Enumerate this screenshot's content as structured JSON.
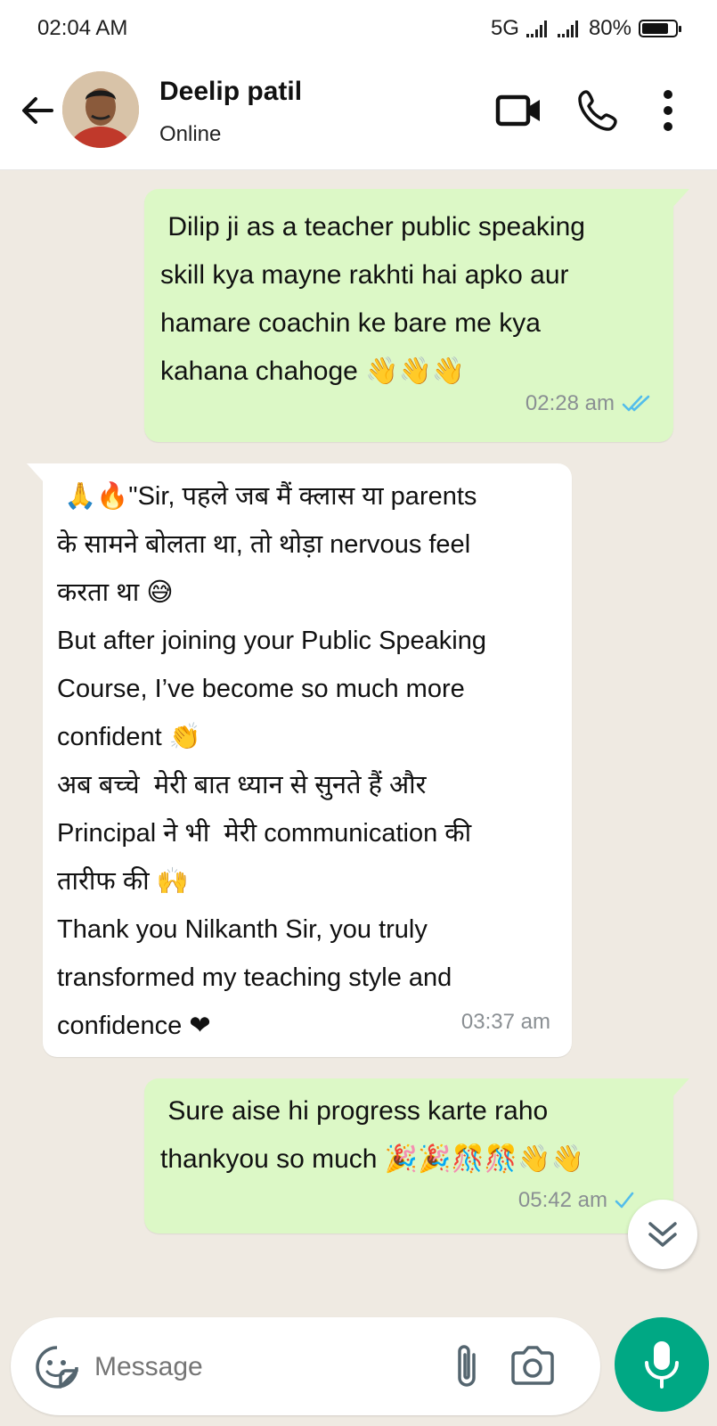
{
  "status_bar": {
    "time": "02:04 AM",
    "network": "5G",
    "battery_percent": "80%",
    "battery_level": 0.8
  },
  "header": {
    "contact_name": "Deelip patil",
    "contact_status": "Online",
    "icons": [
      "back-arrow-icon",
      "video-call-icon",
      "phone-icon",
      "more-vert-icon"
    ]
  },
  "messages": [
    {
      "direction": "outgoing",
      "text": " Dilip ji as a teacher public speaking\nskill kya mayne rakhti hai apko aur\nhamare coachin ke bare me kya\nkahana chahoge 👋👋👋",
      "time": "02:28 am",
      "status": "read"
    },
    {
      "direction": "incoming",
      "text": " 🙏🔥\"Sir, पहले जब मैं क्लास या parents\nके सामने बोलता था, तो थोड़ा nervous feel\nकरता था 😅\nBut after joining your Public Speaking\nCourse, I’ve become so much more\nconfident 👏\nअब बच्चे  मेरी बात ध्यान से सुनते हैं और\nPrincipal ने भी  मेरी communication की\nतारीफ की 🙌\nThank you Nilkanth Sir, you truly\ntransformed my teaching style and\nconfidence ❤",
      "time": "03:37 am"
    },
    {
      "direction": "outgoing",
      "text": " Sure aise hi progress karte raho\nthankyou so much 🎉🎉🎊🎊👋👋",
      "time": "05:42 am",
      "status": "sent"
    }
  ],
  "composer": {
    "placeholder": "Message",
    "icons": [
      "sticker-icon",
      "attach-icon",
      "camera-icon",
      "mic-icon"
    ]
  },
  "colors": {
    "outgoing_bubble": "#dcf8c6",
    "incoming_bubble": "#ffffff",
    "chat_background": "#efeae2",
    "accent": "#00a884",
    "read_tick": "#53bdeb"
  }
}
